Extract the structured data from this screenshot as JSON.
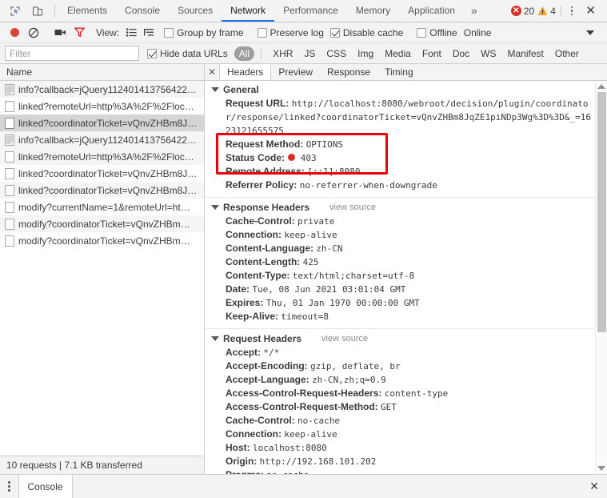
{
  "tabbar": {
    "icons": [
      {
        "name": "inspect-element-icon",
        "label": "Inspect"
      },
      {
        "name": "device-toolbar-icon",
        "label": "Toggle device toolbar"
      }
    ],
    "tabs": [
      {
        "label": "Elements",
        "selected": false
      },
      {
        "label": "Console",
        "selected": false
      },
      {
        "label": "Sources",
        "selected": false
      },
      {
        "label": "Network",
        "selected": true
      },
      {
        "label": "Performance",
        "selected": false
      },
      {
        "label": "Memory",
        "selected": false
      },
      {
        "label": "Application",
        "selected": false
      }
    ],
    "more_label": "»",
    "error_count": "20",
    "warning_count": "4",
    "close_label": "✕"
  },
  "toolbar": {
    "record_label": "Record",
    "clear_label": "Clear",
    "screenshot_label": "Capture screenshots",
    "filter_label": "Filter",
    "view_label": "View:",
    "view_list_label": "List view",
    "view_waterfall_label": "Waterfall view",
    "group_by_frame": {
      "label": "Group by frame",
      "checked": false
    },
    "preserve_log": {
      "label": "Preserve log",
      "checked": false
    },
    "disable_cache": {
      "label": "Disable cache",
      "checked": true
    },
    "offline": {
      "label": "Offline",
      "checked": false
    },
    "throttling": {
      "label": "Online"
    }
  },
  "filterbar": {
    "filter_value": "",
    "filter_placeholder": "Filter",
    "hide_data_urls": {
      "label": "Hide data URLs",
      "checked": true
    },
    "types": [
      {
        "label": "All",
        "active": true
      },
      {
        "label": "XHR",
        "active": false
      },
      {
        "label": "JS",
        "active": false
      },
      {
        "label": "CSS",
        "active": false
      },
      {
        "label": "Img",
        "active": false
      },
      {
        "label": "Media",
        "active": false
      },
      {
        "label": "Font",
        "active": false
      },
      {
        "label": "Doc",
        "active": false
      },
      {
        "label": "WS",
        "active": false
      },
      {
        "label": "Manifest",
        "active": false
      },
      {
        "label": "Other",
        "active": false
      }
    ]
  },
  "requests": {
    "column_header": "Name",
    "rows": [
      {
        "name": "info?callback=jQuery112401413756422…",
        "icon": "document-icon",
        "selected": false
      },
      {
        "name": "linked?remoteUrl=http%3A%2F%2Floc…",
        "icon": "generic-file-icon",
        "selected": false
      },
      {
        "name": "linked?coordinatorTicket=vQnvZHBm8J…",
        "icon": "generic-file-icon",
        "selected": true
      },
      {
        "name": "info?callback=jQuery112401413756422…",
        "icon": "document-icon",
        "selected": false
      },
      {
        "name": "linked?remoteUrl=http%3A%2F%2Floc…",
        "icon": "generic-file-icon",
        "selected": false
      },
      {
        "name": "linked?coordinatorTicket=vQnvZHBm8J…",
        "icon": "generic-file-icon",
        "selected": false
      },
      {
        "name": "linked?coordinatorTicket=vQnvZHBm8J…",
        "icon": "generic-file-icon",
        "selected": false
      },
      {
        "name": "modify?currentName=1&remoteUrl=ht…",
        "icon": "generic-file-icon",
        "selected": false
      },
      {
        "name": "modify?coordinatorTicket=vQnvZHBm…",
        "icon": "generic-file-icon",
        "selected": false
      },
      {
        "name": "modify?coordinatorTicket=vQnvZHBm…",
        "icon": "generic-file-icon",
        "selected": false
      }
    ],
    "status_text": "10 requests  |  7.1 KB transferred"
  },
  "details": {
    "close_label": "✕",
    "tabs": [
      {
        "label": "Headers",
        "selected": true
      },
      {
        "label": "Preview",
        "selected": false
      },
      {
        "label": "Response",
        "selected": false
      },
      {
        "label": "Timing",
        "selected": false
      }
    ],
    "general": {
      "title": "General",
      "rows": [
        {
          "key": "Request URL:",
          "value": "http://localhost:8080/webroot/decision/plugin/coordinator/response/linked?coordinatorTicket=vQnvZHBm8JqZE1piNDp3Wg%3D%3D&_=1623121655575"
        },
        {
          "key": "Request Method:",
          "value": "OPTIONS"
        },
        {
          "key": "Status Code:",
          "value": "403",
          "status_dot": true
        },
        {
          "key": "Remote Address:",
          "value": "[::1]:8080"
        },
        {
          "key": "Referrer Policy:",
          "value": "no-referrer-when-downgrade"
        }
      ]
    },
    "response_headers": {
      "title": "Response Headers",
      "view_source": "view source",
      "rows": [
        {
          "key": "Cache-Control:",
          "value": "private"
        },
        {
          "key": "Connection:",
          "value": "keep-alive"
        },
        {
          "key": "Content-Language:",
          "value": "zh-CN"
        },
        {
          "key": "Content-Length:",
          "value": "425"
        },
        {
          "key": "Content-Type:",
          "value": "text/html;charset=utf-8"
        },
        {
          "key": "Date:",
          "value": "Tue, 08 Jun 2021 03:01:04 GMT"
        },
        {
          "key": "Expires:",
          "value": "Thu, 01 Jan 1970 00:00:00 GMT"
        },
        {
          "key": "Keep-Alive:",
          "value": "timeout=8"
        }
      ]
    },
    "request_headers": {
      "title": "Request Headers",
      "view_source": "view source",
      "rows": [
        {
          "key": "Accept:",
          "value": "*/*"
        },
        {
          "key": "Accept-Encoding:",
          "value": "gzip, deflate, br"
        },
        {
          "key": "Accept-Language:",
          "value": "zh-CN,zh;q=0.9"
        },
        {
          "key": "Access-Control-Request-Headers:",
          "value": "content-type"
        },
        {
          "key": "Access-Control-Request-Method:",
          "value": "GET"
        },
        {
          "key": "Cache-Control:",
          "value": "no-cache"
        },
        {
          "key": "Connection:",
          "value": "keep-alive"
        },
        {
          "key": "Host:",
          "value": "localhost:8080"
        },
        {
          "key": "Origin:",
          "value": "http://192.168.101.202"
        },
        {
          "key": "Pragma:",
          "value": "no-cache"
        }
      ]
    },
    "annotation_color": "#e8000d"
  },
  "drawer": {
    "tab_label": "Console",
    "close_label": "✕"
  }
}
